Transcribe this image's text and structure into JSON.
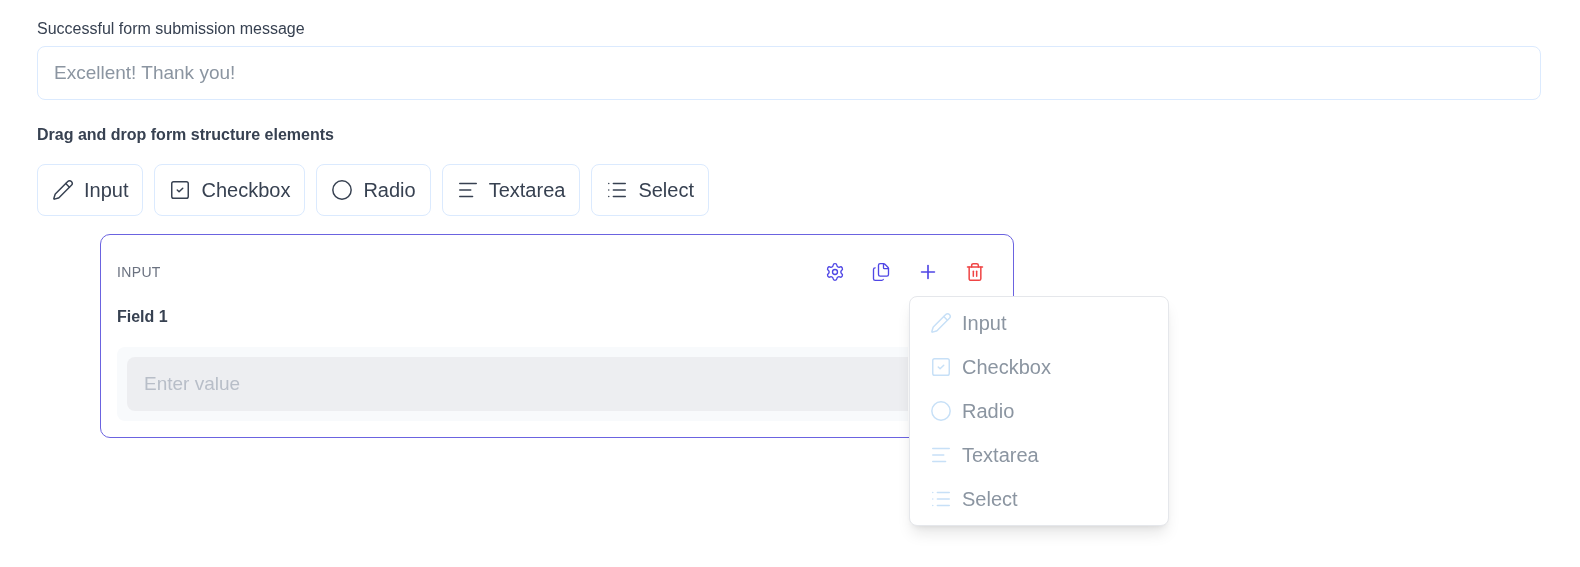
{
  "message_field": {
    "label": "Successful form submission message",
    "placeholder": "Excellent! Thank you!"
  },
  "palette": {
    "heading": "Drag and drop form structure elements",
    "elements": [
      {
        "kind": "input",
        "label": "Input"
      },
      {
        "kind": "checkbox",
        "label": "Checkbox"
      },
      {
        "kind": "radio",
        "label": "Radio"
      },
      {
        "kind": "textarea",
        "label": "Textarea"
      },
      {
        "kind": "select",
        "label": "Select"
      }
    ]
  },
  "field_card": {
    "type_label": "INPUT",
    "field_label": "Field 1",
    "placeholder": "Enter value"
  },
  "add_menu": {
    "items": [
      {
        "kind": "input",
        "label": "Input"
      },
      {
        "kind": "checkbox",
        "label": "Checkbox"
      },
      {
        "kind": "radio",
        "label": "Radio"
      },
      {
        "kind": "textarea",
        "label": "Textarea"
      },
      {
        "kind": "select",
        "label": "Select"
      }
    ]
  }
}
